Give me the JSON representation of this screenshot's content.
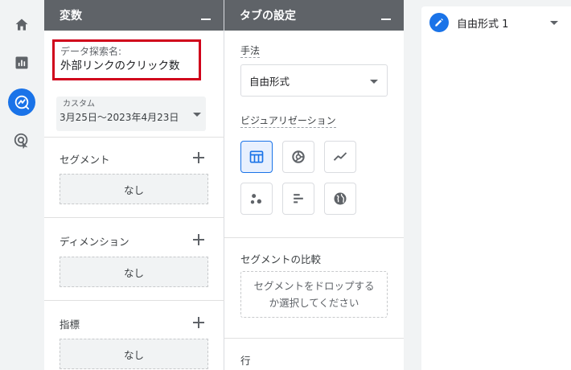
{
  "rail": {
    "items": [
      {
        "name": "home-icon"
      },
      {
        "name": "reports-icon"
      },
      {
        "name": "explore-icon",
        "active": true
      },
      {
        "name": "advertising-icon"
      }
    ]
  },
  "variables": {
    "title": "変数",
    "explore_name_label": "データ探索名:",
    "explore_name_value": "外部リンクのクリック数",
    "date_type": "カスタム",
    "date_range": "3月25日～2023年4月23日",
    "segments_label": "セグメント",
    "segments_value": "なし",
    "dimensions_label": "ディメンション",
    "dimensions_value": "なし",
    "metrics_label": "指標",
    "metrics_value": "なし"
  },
  "tab_settings": {
    "title": "タブの設定",
    "technique_label": "手法",
    "technique_value": "自由形式",
    "viz_label": "ビジュアリゼーション",
    "viz_options": [
      "table-icon",
      "donut-chart-icon",
      "line-chart-icon",
      "scatter-plot-icon",
      "bar-chart-icon",
      "geo-map-icon"
    ],
    "segment_compare_label": "セグメントの比較",
    "segment_compare_drop": "セグメントをドロップする か選択してください",
    "rows_label": "行"
  },
  "canvas": {
    "tab_name": "自由形式 1"
  },
  "colors": {
    "accent": "#1a73e8",
    "panel_header": "#5f6368",
    "highlight_border": "#d0021b"
  }
}
